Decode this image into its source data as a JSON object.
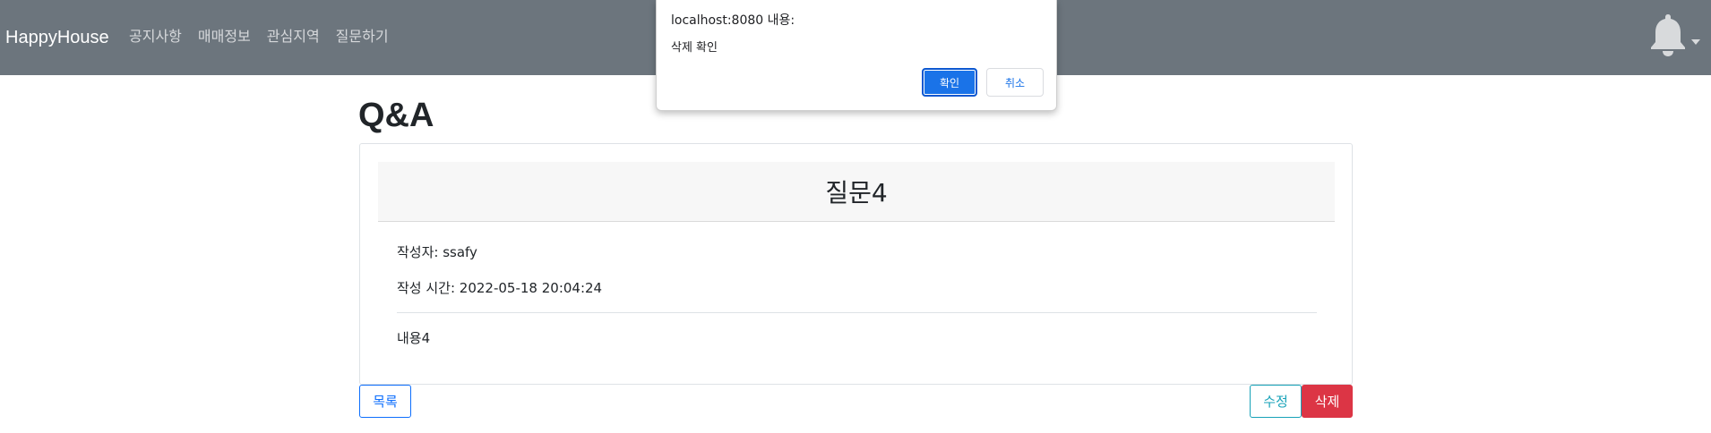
{
  "navbar": {
    "brand": "HappyHouse",
    "links": [
      "공지사항",
      "매매정보",
      "관심지역",
      "질문하기"
    ],
    "background": "#6c757d",
    "notification_icon": "bell-icon"
  },
  "dialog": {
    "title": "localhost:8080 내용:",
    "message": "삭제 확인",
    "ok_label": "확인",
    "cancel_label": "취소"
  },
  "page": {
    "title": "Q&A"
  },
  "question": {
    "subject": "질문4",
    "author_label": "작성자: ssafy",
    "time_label": "작성 시간: 2022-05-18 20:04:24",
    "content": "내용4"
  },
  "actions": {
    "list_label": "목록",
    "edit_label": "수정",
    "delete_label": "삭제"
  },
  "colors": {
    "primary": "#0d6efd",
    "info": "#17a2b8",
    "danger": "#dc3545",
    "dialog_ok": "#1a73e8"
  }
}
